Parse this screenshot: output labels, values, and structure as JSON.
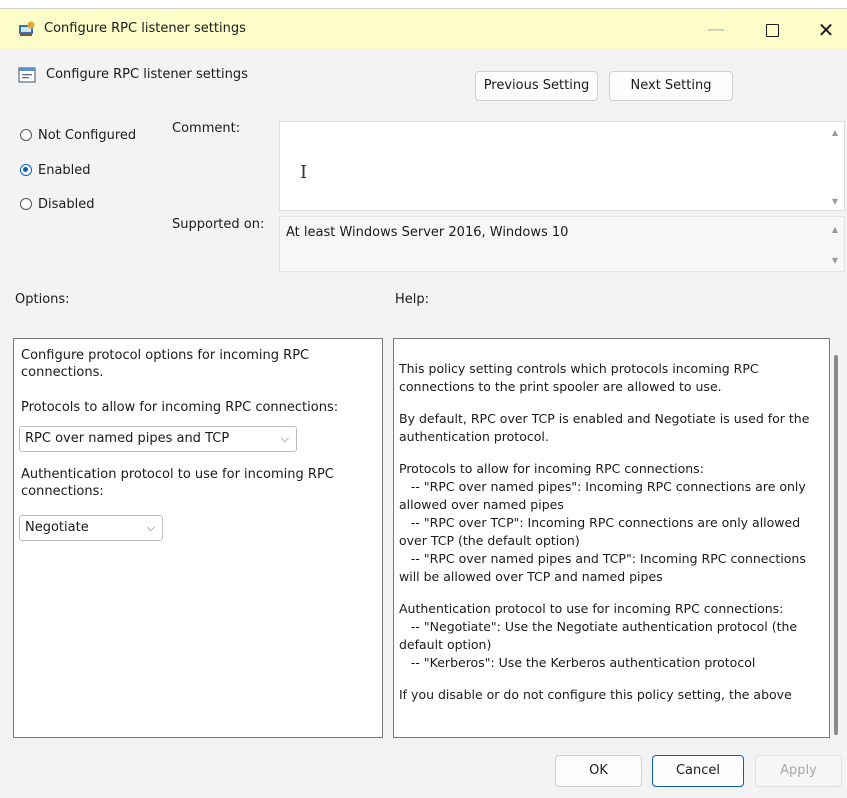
{
  "window": {
    "title": "Configure RPC listener settings",
    "controls": {
      "minimize": "—",
      "close": "✕"
    }
  },
  "header": {
    "policy_name": "Configure RPC listener settings",
    "previous_label": "Previous Setting",
    "next_label": "Next Setting"
  },
  "state": {
    "options": [
      {
        "label": "Not Configured",
        "selected": false
      },
      {
        "label": "Enabled",
        "selected": true
      },
      {
        "label": "Disabled",
        "selected": false
      }
    ]
  },
  "comment": {
    "label": "Comment:",
    "value": "",
    "cursor_glyph": "I"
  },
  "supported": {
    "label": "Supported on:",
    "value": "At least Windows Server 2016, Windows 10"
  },
  "options_pane": {
    "label": "Options:",
    "intro": "Configure protocol options for incoming RPC connections.",
    "protocols_label": "Protocols to allow for incoming RPC connections:",
    "protocols_value": "RPC over named pipes and TCP",
    "auth_label": "Authentication protocol to use for incoming RPC connections:",
    "auth_value": "Negotiate"
  },
  "help_pane": {
    "label": "Help:",
    "paragraphs": [
      "This policy setting controls which protocols incoming RPC connections to the print spooler are allowed to use.",
      "By default, RPC over TCP is enabled and Negotiate is used for the authentication protocol.",
      "Protocols to allow for incoming RPC connections:\n   -- \"RPC over named pipes\": Incoming RPC connections are only allowed over named pipes\n   -- \"RPC over TCP\": Incoming RPC connections are only allowed over TCP (the default option)\n   -- \"RPC over named pipes and TCP\": Incoming RPC connections will be allowed over TCP and named pipes",
      "Authentication protocol to use for incoming RPC connections:\n   -- \"Negotiate\": Use the Negotiate authentication protocol (the default option)\n   -- \"Kerberos\": Use the Kerberos authentication protocol",
      "If you disable or do not configure this policy setting, the above"
    ]
  },
  "footer": {
    "ok_label": "OK",
    "cancel_label": "Cancel",
    "apply_label": "Apply"
  },
  "colors": {
    "titlebar": "#fdfdc9",
    "accent": "#0a5fbd",
    "dialog_bg": "#f3f3f3"
  },
  "icons": {
    "app": "policy-app-icon",
    "policy": "policy-setting-icon"
  }
}
